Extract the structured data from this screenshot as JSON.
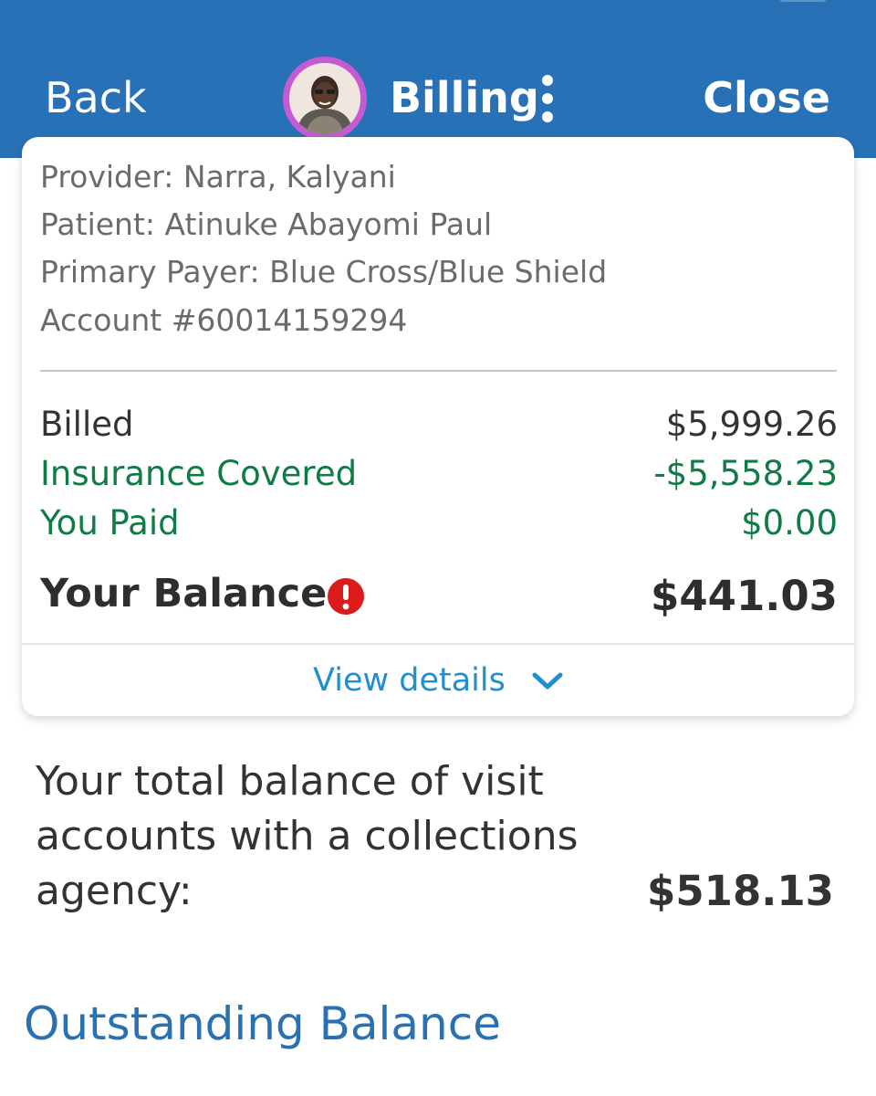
{
  "header": {
    "back_label": "Back",
    "title": "Billing",
    "close_label": "Close",
    "menu_icon": "more-vertical-icon",
    "avatar_icon": "user-avatar",
    "background_color": "#2871b6"
  },
  "visit": {
    "provider": "Provider: Narra, Kalyani",
    "patient": "Patient: Atinuke Abayomi Paul",
    "payer": "Primary Payer: Blue Cross/Blue Shield",
    "account": "Account #60014159294"
  },
  "summary": {
    "billed_label": "Billed",
    "billed_value": "$5,999.26",
    "insurance_label": "Insurance Covered",
    "insurance_value": "-$5,558.23",
    "paid_label": "You Paid",
    "paid_value": "$0.00",
    "balance_label": "Your Balance",
    "balance_value": "$441.03",
    "alert_icon": "alert-exclamation-icon",
    "accent_green": "#0f7b45"
  },
  "details": {
    "label": "View details",
    "icon": "chevron-down-icon",
    "color": "#1f8fd0"
  },
  "collections": {
    "text": "Your total balance of visit accounts with a collections agency:",
    "amount": "$518.13"
  },
  "section": {
    "heading": "Outstanding Balance"
  }
}
